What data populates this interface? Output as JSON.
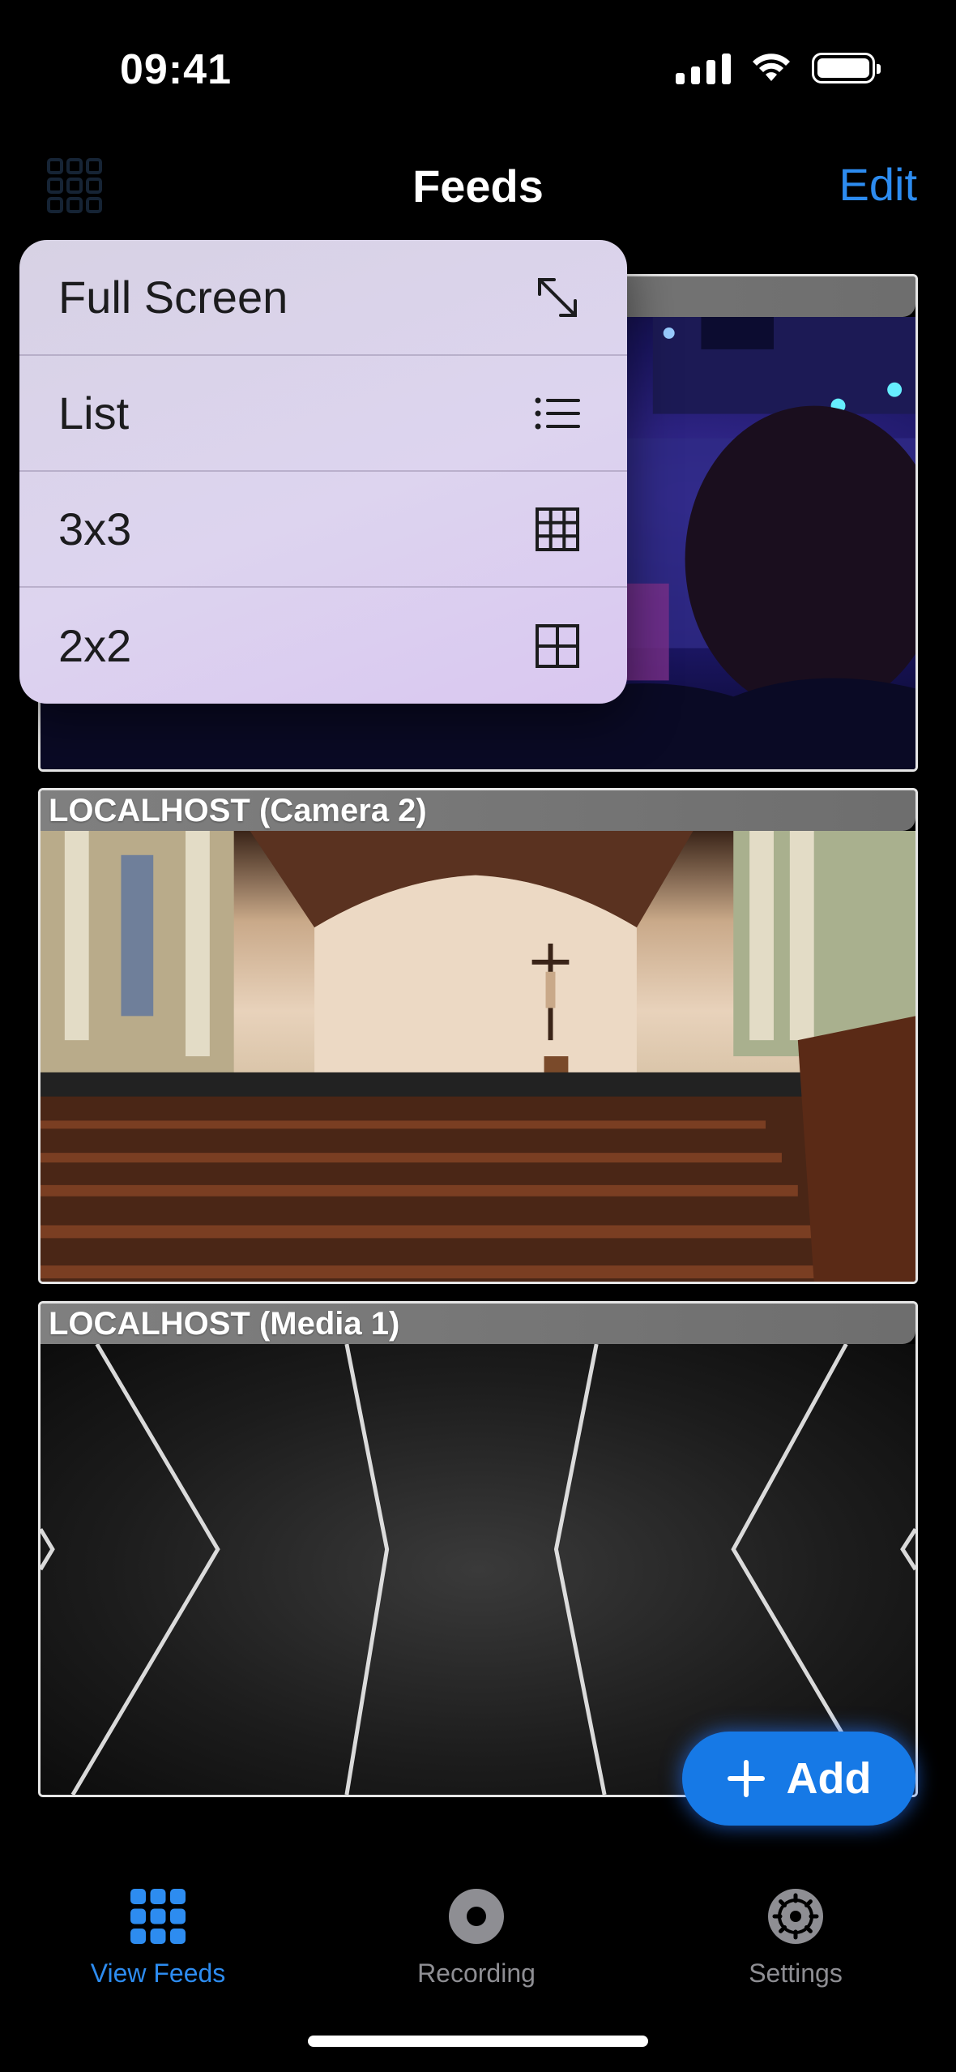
{
  "status_bar": {
    "time": "09:41"
  },
  "nav": {
    "title": "Feeds",
    "edit_label": "Edit"
  },
  "menu": {
    "items": [
      {
        "label": "Full Screen",
        "icon": "expand-icon"
      },
      {
        "label": "List",
        "icon": "list-icon"
      },
      {
        "label": "3x3",
        "icon": "grid-3x3-icon"
      },
      {
        "label": "2x2",
        "icon": "grid-2x2-icon"
      }
    ]
  },
  "feeds": [
    {
      "label": "",
      "scene": "concert"
    },
    {
      "label": "LOCALHOST (Camera 2)",
      "scene": "church"
    },
    {
      "label": "LOCALHOST (Media 1)",
      "scene": "media"
    }
  ],
  "add_button": {
    "label": "Add"
  },
  "tabs": [
    {
      "label": "View Feeds",
      "icon": "grid-icon",
      "active": true
    },
    {
      "label": "Recording",
      "icon": "record-icon",
      "active": false
    },
    {
      "label": "Settings",
      "icon": "gear-icon",
      "active": false
    }
  ],
  "colors": {
    "accent": "#2d8cf0",
    "add_button": "#1679e6",
    "inactive_tab": "#8e8e93"
  }
}
